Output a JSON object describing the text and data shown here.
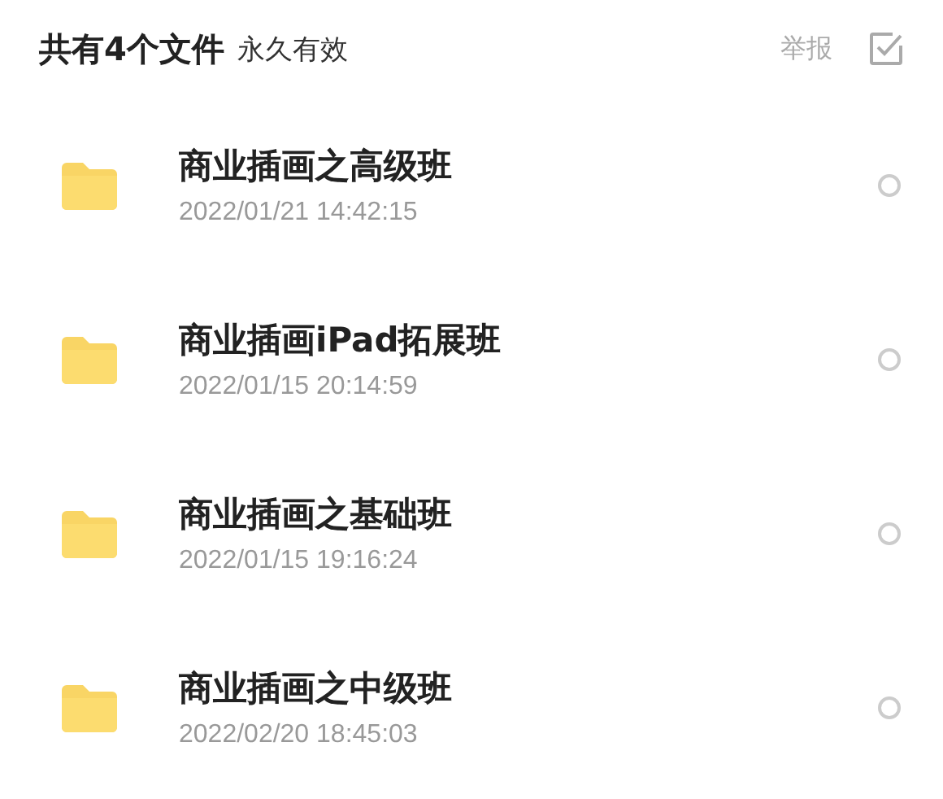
{
  "header": {
    "title": "共有4个文件",
    "subtitle": "永久有效",
    "report": "举报"
  },
  "files": [
    {
      "name": "商业插画之高级班",
      "date": "2022/01/21 14:42:15",
      "selected": false
    },
    {
      "name": "商业插画iPad拓展班",
      "date": "2022/01/15 20:14:59",
      "selected": false
    },
    {
      "name": "商业插画之基础班",
      "date": "2022/01/15 19:16:24",
      "selected": false
    },
    {
      "name": "商业插画之中级班",
      "date": "2022/02/20 18:45:03",
      "selected": false
    }
  ]
}
